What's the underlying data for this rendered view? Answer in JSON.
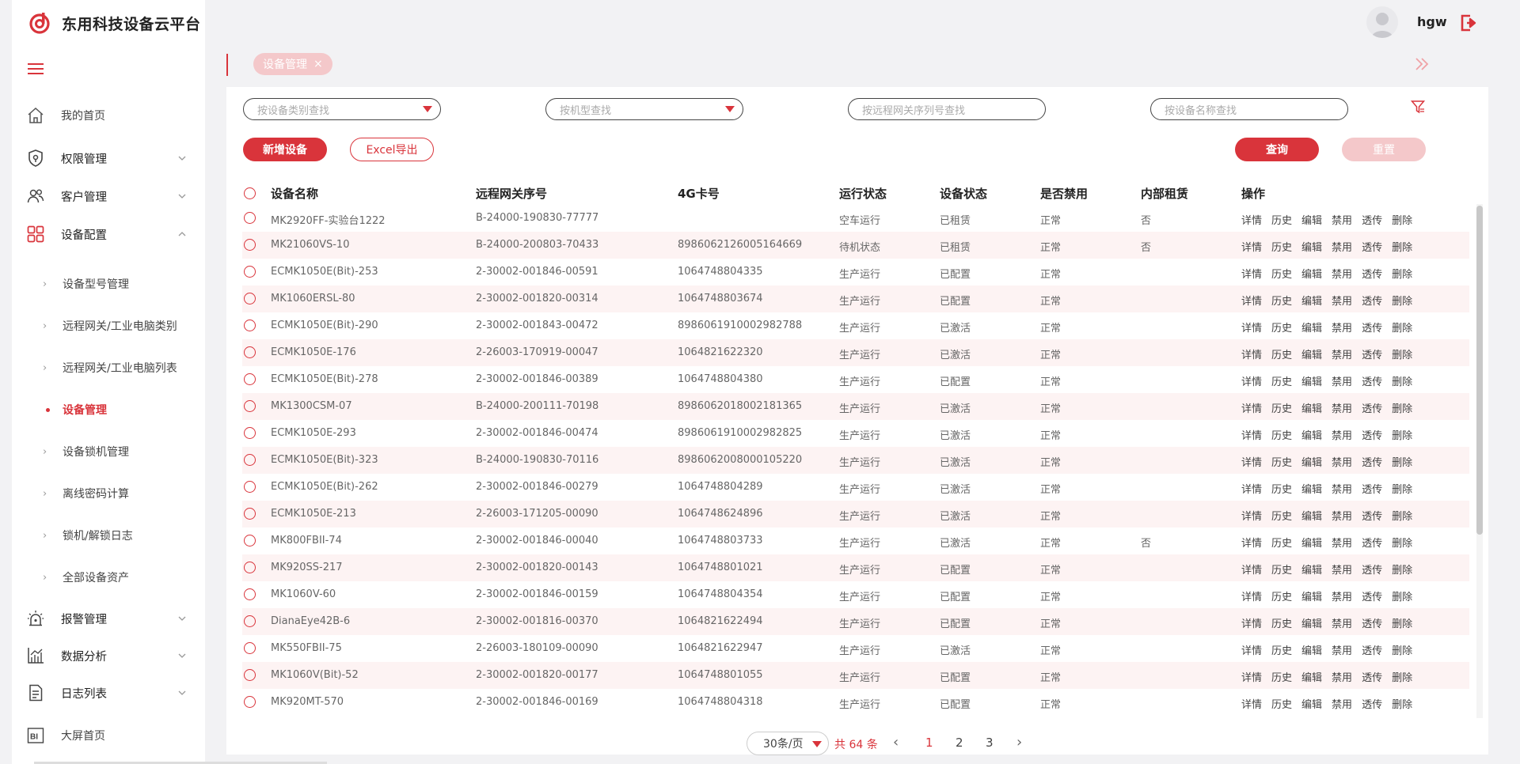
{
  "app": {
    "title": "东用科技设备云平台",
    "brand_color": "#d9343b"
  },
  "header": {
    "username": "hgw"
  },
  "sidebar": {
    "items": [
      {
        "label": "我的首页",
        "icon": "home-icon"
      },
      {
        "label": "权限管理",
        "icon": "shield-icon"
      },
      {
        "label": "客户管理",
        "icon": "users-icon"
      },
      {
        "label": "设备配置",
        "icon": "grid-icon"
      },
      {
        "label": "报警管理",
        "icon": "alarm-icon"
      },
      {
        "label": "数据分析",
        "icon": "chart-icon"
      },
      {
        "label": "日志列表",
        "icon": "document-icon"
      },
      {
        "label": "大屏首页",
        "icon": "bi-icon"
      }
    ],
    "subitems": [
      {
        "label": "设备型号管理"
      },
      {
        "label": "远程网关/工业电脑类别"
      },
      {
        "label": "远程网关/工业电脑列表"
      },
      {
        "label": "设备管理",
        "active": true
      },
      {
        "label": "设备锁机管理"
      },
      {
        "label": "离线密码计算"
      },
      {
        "label": "锁机/解锁日志"
      },
      {
        "label": "全部设备资产"
      }
    ]
  },
  "tabs": [
    {
      "label": "设备管理",
      "close": "×"
    }
  ],
  "filters": {
    "category_placeholder": "按设备类别查找",
    "model_placeholder": "按机型查找",
    "gateway_placeholder": "按远程网关序列号查找",
    "name_placeholder": "按设备名称查找"
  },
  "toolbar": {
    "add_label": "新增设备",
    "export_label": "Excel导出",
    "query_label": "查询",
    "reset_label": "重置"
  },
  "table": {
    "columns": [
      "设备名称",
      "远程网关序号",
      "4G卡号",
      "运行状态",
      "设备状态",
      "是否禁用",
      "内部租赁",
      "操作"
    ],
    "actions": [
      "详情",
      "历史",
      "编辑",
      "禁用",
      "透传",
      "删除"
    ],
    "rows": [
      [
        "MK2920FF-实验台1222",
        "B-24000-190830-77777",
        "",
        "空车运行",
        "已租赁",
        "正常",
        "否"
      ],
      [
        "MK21060VS-10",
        "B-24000-200803-70433",
        "8986062126005164669",
        "待机状态",
        "已租赁",
        "正常",
        "否"
      ],
      [
        "ECMK1050E(Bit)-253",
        "2-30002-001846-00591",
        "1064748804335",
        "生产运行",
        "已配置",
        "正常",
        ""
      ],
      [
        "MK1060ERSL-80",
        "2-30002-001820-00314",
        "1064748803674",
        "生产运行",
        "已配置",
        "正常",
        ""
      ],
      [
        "ECMK1050E(Bit)-290",
        "2-30002-001843-00472",
        "8986061910002982788",
        "生产运行",
        "已激活",
        "正常",
        ""
      ],
      [
        "ECMK1050E-176",
        "2-26003-170919-00047",
        "1064821622320",
        "生产运行",
        "已激活",
        "正常",
        ""
      ],
      [
        "ECMK1050E(Bit)-278",
        "2-30002-001846-00389",
        "1064748804380",
        "生产运行",
        "已配置",
        "正常",
        ""
      ],
      [
        "MK1300CSM-07",
        "B-24000-200111-70198",
        "8986062018002181365",
        "生产运行",
        "已激活",
        "正常",
        ""
      ],
      [
        "ECMK1050E-293",
        "2-30002-001846-00474",
        "8986061910002982825",
        "生产运行",
        "已激活",
        "正常",
        ""
      ],
      [
        "ECMK1050E(Bit)-323",
        "B-24000-190830-70116",
        "8986062008000105220",
        "生产运行",
        "已激活",
        "正常",
        ""
      ],
      [
        "ECMK1050E(Bit)-262",
        "2-30002-001846-00279",
        "1064748804289",
        "生产运行",
        "已激活",
        "正常",
        ""
      ],
      [
        "ECMK1050E-213",
        "2-26003-171205-00090",
        "1064748624896",
        "生产运行",
        "已激活",
        "正常",
        ""
      ],
      [
        "MK800FBII-74",
        "2-30002-001846-00040",
        "1064748803733",
        "生产运行",
        "已激活",
        "正常",
        "否"
      ],
      [
        "MK920SS-217",
        "2-30002-001820-00143",
        "1064748801021",
        "生产运行",
        "已配置",
        "正常",
        ""
      ],
      [
        "MK1060V-60",
        "2-30002-001846-00159",
        "1064748804354",
        "生产运行",
        "已配置",
        "正常",
        ""
      ],
      [
        "DianaEye42B-6",
        "2-30002-001816-00370",
        "1064821622494",
        "生产运行",
        "已配置",
        "正常",
        ""
      ],
      [
        "MK550FBII-75",
        "2-26003-180109-00090",
        "1064821622947",
        "生产运行",
        "已激活",
        "正常",
        ""
      ],
      [
        "MK1060V(Bit)-52",
        "2-30002-001820-00177",
        "1064748801055",
        "生产运行",
        "已配置",
        "正常",
        ""
      ],
      [
        "MK920MT-570",
        "2-30002-001846-00169",
        "1064748804318",
        "生产运行",
        "已配置",
        "正常",
        ""
      ]
    ]
  },
  "pagination": {
    "page_size": "30条/页",
    "total": "共 64 条",
    "pages": [
      "1",
      "2",
      "3"
    ],
    "current": "1",
    "prev": "‹",
    "next": "›"
  }
}
